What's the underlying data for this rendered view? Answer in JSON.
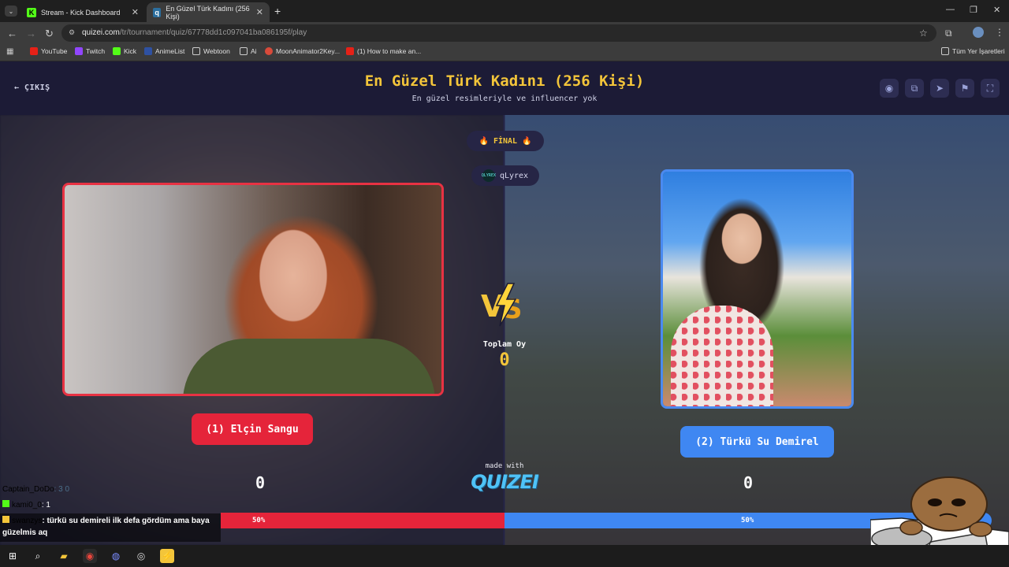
{
  "browser": {
    "tabs": [
      {
        "title": "Stream - Kick Dashboard",
        "active": false,
        "icon": "kick-icon"
      },
      {
        "title": "En Güzel Türk Kadını (256 Kişi)",
        "active": true,
        "icon": "quizei-icon"
      }
    ],
    "url_domain": "quizei.com",
    "url_path": "/tr/tournament/quiz/67778dd1c097041ba086195f/play",
    "bookmarks": [
      "YouTube",
      "Twitch",
      "Kick",
      "AnimeList",
      "Webtoon",
      "Ai",
      "MoonAnimator2Key...",
      "(1) How to make an...",
      "Tüm Yer İşaretleri"
    ]
  },
  "header": {
    "exit_label": "ÇIKIŞ",
    "title": "En Güzel Türk Kadını (256 Kişi)",
    "subtitle": "En güzel resimleriyle ve influencer yok"
  },
  "match": {
    "stage": "🔥 FİNAL 🔥",
    "user": "qLyrex",
    "user_avatar_text": "QLYREX",
    "total_label": "Toplam Oy",
    "total_value": "0",
    "made_with": "made with",
    "logo_text": "QUIZEI",
    "left": {
      "name": "(1) Elçin Sangu",
      "score": "0",
      "percent": "50%",
      "percent_value": 50,
      "color": "#e5243a"
    },
    "right": {
      "name": "(2) Türkü Su Demirel",
      "score": "0",
      "percent": "50%",
      "percent_value": 50,
      "color": "#3f87f2"
    }
  },
  "chat": [
    {
      "user": "Captain_DoDo",
      "text": ": 3 0"
    },
    {
      "user": "kami0_0",
      "text": ": 1"
    },
    {
      "user": "swanzys",
      "text": ": türkü su demireli ilk defa gördüm ama baya"
    },
    {
      "user": "",
      "text": "güzelmis aq"
    }
  ],
  "colors": {
    "accent": "#f3c53a",
    "header_bg": "#1c1b36"
  }
}
